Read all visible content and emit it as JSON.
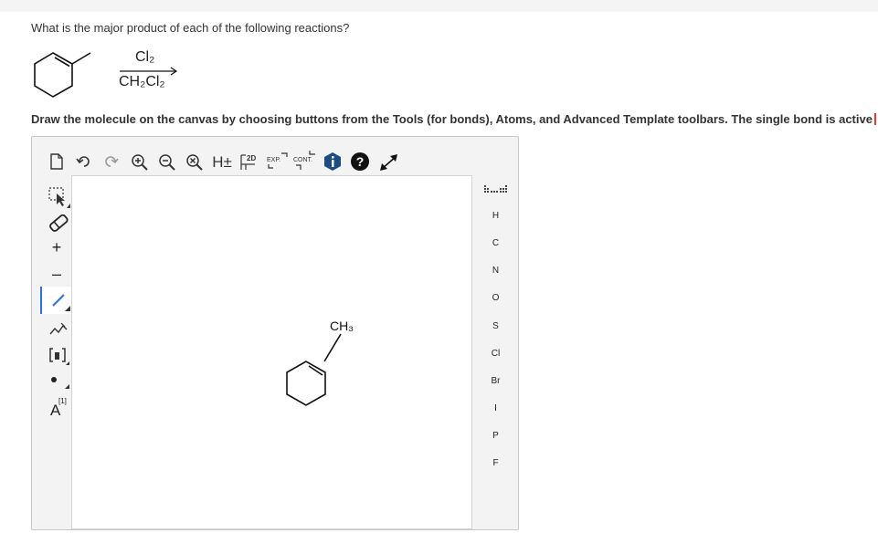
{
  "question": "What is the major product of each of the following reactions?",
  "reaction": {
    "reagent_top": "Cl₂",
    "reagent_bottom": "CH₂Cl₂"
  },
  "instruction": "Draw the molecule on the canvas by choosing buttons from the Tools (for bonds), Atoms, and Advanced Template toolbars. The single bond is active",
  "toolbar": {
    "h_toggle_label": "H±",
    "twod_label": "2D",
    "exp_label": "EXP.",
    "cont_label": "CONT."
  },
  "left_toolbar": {
    "charge_plus": "+",
    "charge_minus": "–",
    "atom_label": "A",
    "atom_index": "[1]"
  },
  "atoms": [
    "H",
    "C",
    "N",
    "O",
    "S",
    "Cl",
    "Br",
    "I",
    "P",
    "F"
  ],
  "canvas": {
    "methyl_label": "CH₃"
  },
  "colors": {
    "active_tool": "#2f6fd6",
    "accent_info": "#1b4c86"
  }
}
